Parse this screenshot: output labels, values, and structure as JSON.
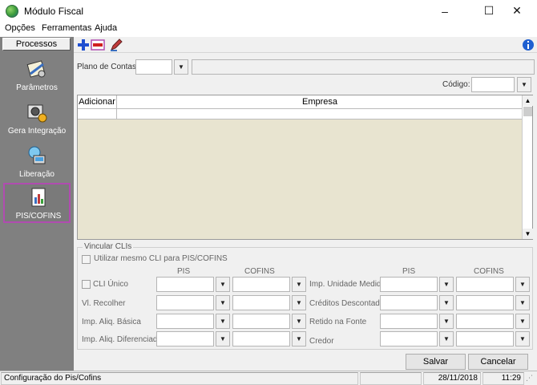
{
  "window": {
    "title": "Módulo Fiscal",
    "controls": [
      "–",
      "☐",
      "✕"
    ]
  },
  "menu": [
    {
      "label": "Opções"
    },
    {
      "label": "Ferramentas"
    },
    {
      "label": "Ajuda"
    }
  ],
  "sidebar": {
    "header": "Processos",
    "items": [
      {
        "label": "Parâmetros"
      },
      {
        "label": "Gera Integração"
      },
      {
        "label": "Liberação"
      },
      {
        "label": "PIS/COFINS"
      }
    ]
  },
  "filters": {
    "plano_label": "Plano de Contas:",
    "codigo_label": "Código:"
  },
  "grid": {
    "columns": [
      "Adicionar",
      "Empresa"
    ]
  },
  "vincular": {
    "title": "Vincular CLIs",
    "same_cli_label": "Utilizar mesmo CLI para PIS/COFINS",
    "col_pis": "PIS",
    "col_cofins": "COFINS",
    "left_rows": [
      "CLI Único",
      "Vl. Recolher",
      "Imp. Aliq. Básica",
      "Imp. Aliq. Diferenciada"
    ],
    "right_rows": [
      "Imp. Unidade Medida",
      "Créditos Descontados",
      "Retido na Fonte",
      "Credor"
    ]
  },
  "buttons": {
    "save": "Salvar",
    "cancel": "Cancelar"
  },
  "status": {
    "message": "Configuração do Pis/Cofins",
    "date": "28/11/2018",
    "time": "11:29"
  },
  "colors": {
    "sidebar_bg": "#808080",
    "active_border": "#b04cb0",
    "grid_bg": "#e8e4d0"
  }
}
